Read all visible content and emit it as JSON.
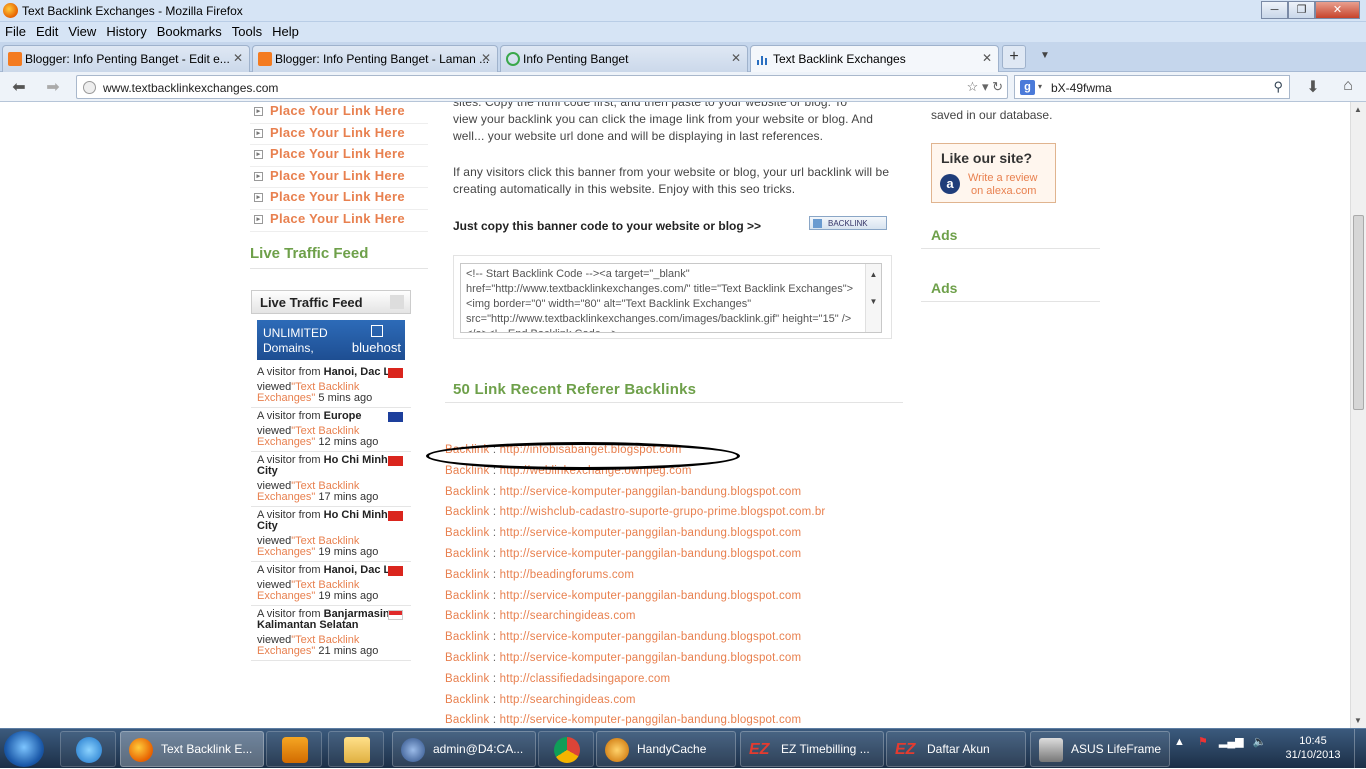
{
  "window": {
    "title": "Text Backlink Exchanges - Mozilla Firefox",
    "controls": [
      "─",
      "❐",
      "✕"
    ]
  },
  "menu": [
    "File",
    "Edit",
    "View",
    "History",
    "Bookmarks",
    "Tools",
    "Help"
  ],
  "tabs": [
    {
      "label": "Blogger: Info Penting Banget - Edit e...",
      "icon": "blogger-icon",
      "color": "#f47b20"
    },
    {
      "label": "Blogger: Info Penting Banget - Laman ...",
      "icon": "blogger-icon",
      "color": "#f47b20"
    },
    {
      "label": "Info Penting Banget",
      "icon": "loading-icon",
      "color": "#3aa84b"
    },
    {
      "label": "Text Backlink Exchanges",
      "icon": "bar-chart-icon",
      "color": "#2a6fc0"
    }
  ],
  "nav": {
    "url": "www.textbacklinkexchanges.com",
    "search": "bX-49fwma"
  },
  "sidebar": {
    "place_items": [
      "Place Your Link Here",
      "Place Your Link Here",
      "Place Your Link Here",
      "Place Your Link Here",
      "Place Your Link Here",
      "Place Your Link Here"
    ],
    "heading": "Live Traffic Feed",
    "feed_title": "Live Traffic Feed",
    "banner": {
      "line1": "UNLIMITED",
      "line2": "Domains,",
      "brand": "bluehost"
    },
    "visitors": [
      {
        "prefix": "A visitor from ",
        "place": "Hanoi, Dac Lac",
        "viewed": "viewed ",
        "page": "\"Text Backlink Exchanges\"",
        "ago": " 5 mins ago",
        "flag": "vn"
      },
      {
        "prefix": "A visitor from ",
        "place": "Europe",
        "viewed": "viewed ",
        "page": "\"Text Backlink Exchanges\"",
        "ago": " 12 mins ago",
        "flag": "eu"
      },
      {
        "prefix": "A visitor from ",
        "place": "Ho Chi Minh City",
        "viewed": "viewed ",
        "page": "\"Text Backlink Exchanges\"",
        "ago": " 17 mins ago",
        "flag": "vn"
      },
      {
        "prefix": "A visitor from ",
        "place": "Ho Chi Minh City",
        "viewed": "viewed ",
        "page": "\"Text Backlink Exchanges\"",
        "ago": " 19 mins ago",
        "flag": "vn"
      },
      {
        "prefix": "A visitor from ",
        "place": "Hanoi, Dac Lac",
        "viewed": "viewed ",
        "page": "\"Text Backlink Exchanges\"",
        "ago": " 19 mins ago",
        "flag": "vn"
      },
      {
        "prefix": "A visitor from ",
        "place": "Banjarmasin, Kalimantan Selatan",
        "viewed": "viewed ",
        "page": "\"Text Backlink Exchanges\"",
        "ago": " 21 mins ago",
        "flag": "id"
      }
    ]
  },
  "main": {
    "para1_line0": "sites. Copy the html code first, and then paste to your website or blog. To",
    "para1": "view your backlink you can click the image link from your website or blog. And well... your website url done and will be displaying in last references.",
    "para2": "If any visitors click this banner from your website or blog, your url backlink will be creating automatically in this website. Enjoy with this seo tricks.",
    "copy_label": "Just copy this banner code to your website or blog >>",
    "backlink_button": "BACKLINK",
    "code": "<!-- Start Backlink Code --><a target=\"_blank\" href=\"http://www.textbacklinkexchanges.com/\" title=\"Text Backlink Exchanges\"><img border=\"0\" width=\"80\" alt=\"Text Backlink Exchanges\" src=\"http://www.textbacklinkexchanges.com/images/backlink.gif\" height=\"15\" /></a><!-- End Backlink Code -->",
    "recent_title": "50 Link Recent Referer Backlinks",
    "referers": [
      "http://infobisabanget.blogspot.com",
      "http://weblinkexchange.ownpeg.com",
      "http://service-komputer-panggilan-bandung.blogspot.com",
      "http://wishclub-cadastro-suporte-grupo-prime.blogspot.com.br",
      "http://service-komputer-panggilan-bandung.blogspot.com",
      "http://service-komputer-panggilan-bandung.blogspot.com",
      "http://beadingforums.com",
      "http://service-komputer-panggilan-bandung.blogspot.com",
      "http://searchingideas.com",
      "http://service-komputer-panggilan-bandung.blogspot.com",
      "http://service-komputer-panggilan-bandung.blogspot.com",
      "http://classifiedadsingapore.com",
      "http://searchingideas.com",
      "http://service-komputer-panggilan-bandung.blogspot.com"
    ],
    "ref_label": "Backlink",
    "ref_sep": " : "
  },
  "right": {
    "saved": "saved in our database.",
    "like": "Like our site?",
    "review1": "Write a review",
    "review2": "on alexa.com",
    "ads1": "Ads",
    "ads2": "Ads"
  },
  "taskbar": {
    "items": [
      {
        "label": "Text Backlink E...",
        "icon": "firefox-icon",
        "active": true
      },
      {
        "label": "admin@D4:CA...",
        "icon": "terminal-icon"
      },
      {
        "label": "HandyCache",
        "icon": "handycache-icon"
      },
      {
        "label": "EZ Timebilling ...",
        "icon": "ez-icon"
      },
      {
        "label": "Daftar Akun",
        "icon": "ez-icon"
      },
      {
        "label": "ASUS LifeFrame",
        "icon": "camera-icon"
      }
    ],
    "time": "10:45",
    "date": "31/10/2013"
  },
  "colors": {
    "link": "#e8804f",
    "heading_green": "#6ea04a"
  }
}
